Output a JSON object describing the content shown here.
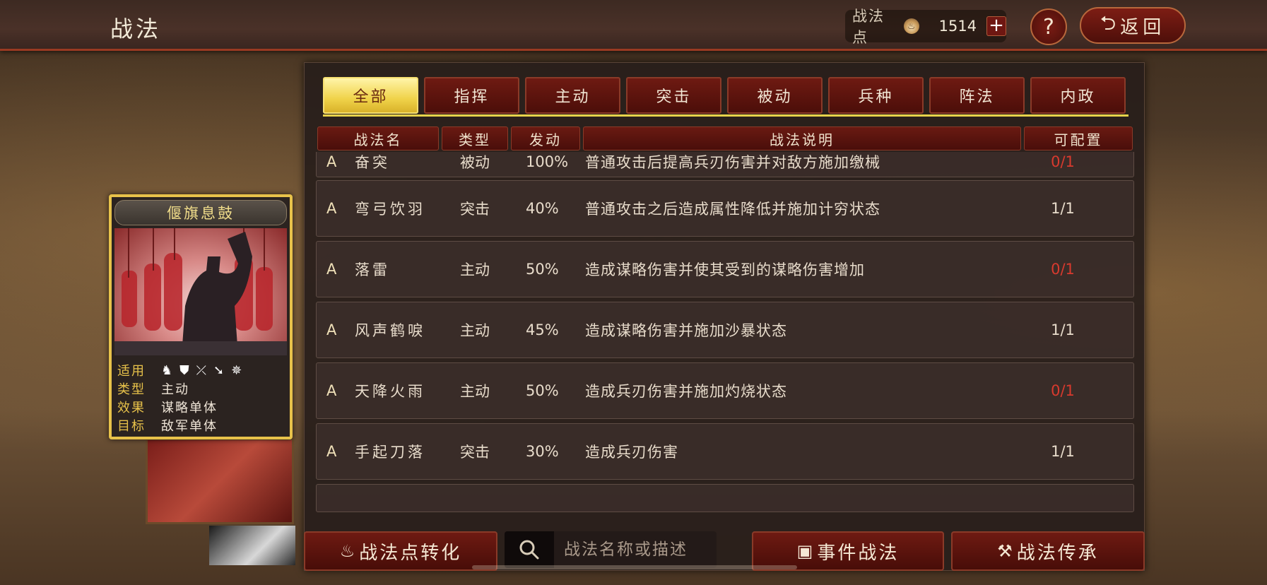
{
  "header": {
    "title": "战法",
    "points_label": "战法点",
    "points_value": "1514",
    "plus_label": "+",
    "help_label": "?",
    "back_label": "返回"
  },
  "tabs": [
    "全部",
    "指挥",
    "主动",
    "突击",
    "被动",
    "兵种",
    "阵法",
    "内政"
  ],
  "active_tab": "全部",
  "columns": [
    "战法名",
    "类型",
    "发动",
    "战法说明",
    "可配置"
  ],
  "rows": [
    {
      "grade": "A",
      "name": "奋突",
      "type": "被动",
      "rate": "100%",
      "desc": "普通攻击后提高兵刃伤害并对敌方施加缴械",
      "cfg": "0/1",
      "cfg_color": "#d83a2e"
    },
    {
      "grade": "A",
      "name": "弯弓饮羽",
      "type": "突击",
      "rate": "40%",
      "desc": "普通攻击之后造成属性降低并施加计穷状态",
      "cfg": "1/1",
      "cfg_color": "#e8dccb"
    },
    {
      "grade": "A",
      "name": "落雷",
      "type": "主动",
      "rate": "50%",
      "desc": "造成谋略伤害并使其受到的谋略伤害增加",
      "cfg": "0/1",
      "cfg_color": "#d83a2e"
    },
    {
      "grade": "A",
      "name": "风声鹤唳",
      "type": "主动",
      "rate": "45%",
      "desc": "造成谋略伤害并施加沙暴状态",
      "cfg": "1/1",
      "cfg_color": "#e8dccb"
    },
    {
      "grade": "A",
      "name": "天降火雨",
      "type": "主动",
      "rate": "50%",
      "desc": "造成兵刃伤害并施加灼烧状态",
      "cfg": "0/1",
      "cfg_color": "#d83a2e"
    },
    {
      "grade": "A",
      "name": "手起刀落",
      "type": "突击",
      "rate": "30%",
      "desc": "造成兵刃伤害",
      "cfg": "1/1",
      "cfg_color": "#e8dccb"
    }
  ],
  "card": {
    "title": "偃旗息鼓",
    "applies_label": "适用",
    "type_label": "类型",
    "type_value": "主动",
    "effect_label": "效果",
    "effect_value": "谋略单体",
    "target_label": "目标",
    "target_value": "敌军单体",
    "unit_icons": [
      "cavalry-icon",
      "shield-icon",
      "archer-icon",
      "spear-icon",
      "chariot-icon"
    ]
  },
  "bottom": {
    "convert_label": "战法点转化",
    "search_placeholder": "战法名称或描述",
    "event_label": "事件战法",
    "inherit_label": "战法传承"
  }
}
